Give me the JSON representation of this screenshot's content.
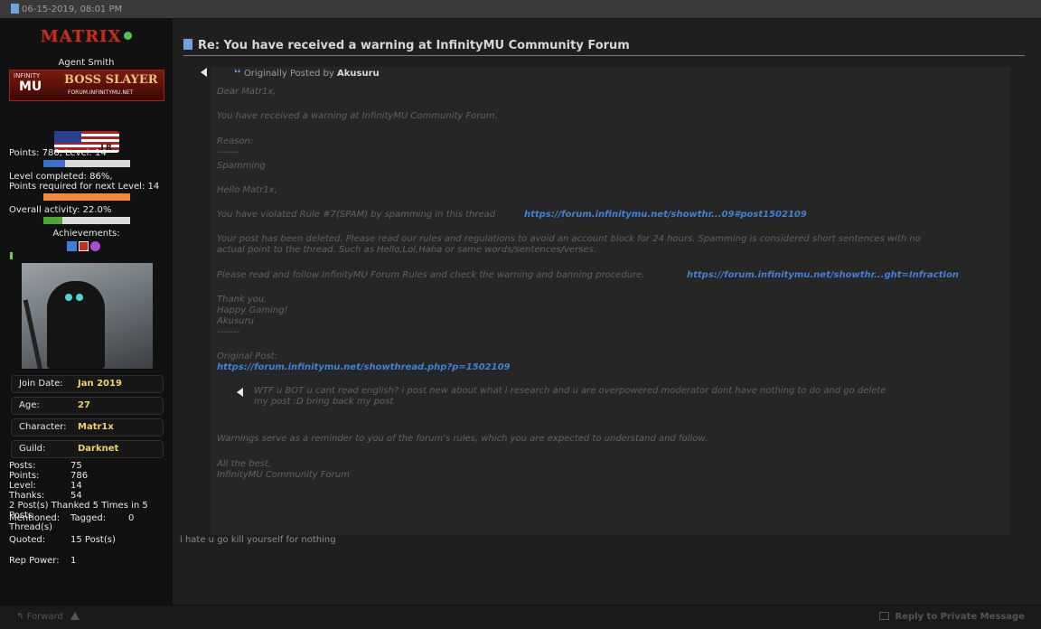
{
  "header": {
    "date": "06-15-2019, 08:01 PM"
  },
  "sidebar": {
    "username": "MATRIX",
    "user_title": "Agent Smith",
    "banner": {
      "line1": "INFINITY",
      "line2": "BOSS SLAYER",
      "line3": "FORUM.INFINITYMU.NET",
      "mu": "MU"
    },
    "flag_label": ".LR",
    "points_level": "Points: 786, Level: 14",
    "level_completed": "Level completed: 86%,",
    "points_required": "Points required for next Level: 14",
    "overall_activity": "Overall activity: 22.0%",
    "achievements_label": "Achievements:",
    "progress": {
      "level_fill": 0.25,
      "points_fill": 1.0,
      "activity_fill": 0.22
    },
    "info_rows": [
      {
        "label": "Join Date:",
        "value": "Jan 2019"
      },
      {
        "label": "Age:",
        "value": "27"
      },
      {
        "label": "Character:",
        "value": "Matr1x"
      },
      {
        "label": "Guild:",
        "value": "Darknet"
      }
    ],
    "posts_label": "Posts:",
    "posts_value": "75",
    "points_label": "Points:",
    "points_value": "786",
    "level_label": "Level:",
    "level_value": "14",
    "thanks_label": "Thanks:",
    "thanks_value": "54",
    "thanked_line": "2 Post(s) Thanked 5 Times in 5 Posts",
    "mentioned_label": "Mentioned:",
    "thread_label": "Thread(s)",
    "tagged_label": "Tagged:",
    "tagged_value": "0",
    "quoted_label": "Quoted:",
    "quoted_value": "15 Post(s)",
    "rep_label": "Rep Power:",
    "rep_value": "1"
  },
  "post": {
    "title": "Re: You have received a warning at InfinityMU Community Forum",
    "quote": {
      "head_prefix": "Originally Posted by",
      "author": "Akusuru",
      "lines": [
        "Dear Matr1x,",
        "You have received a warning at InfinityMU Community Forum.",
        "Reason:",
        "-------",
        "Spamming",
        "Hello Matr1x,",
        "You have violated Rule #7(SPAM) by spamming in this thread",
        "Your post has been deleted. Please read our rules and regulations to avoid an account block for 24 hours. Spamming is considered short sentences with no",
        "actual point to the thread. Such as Hello,Lol,Haha or same words/sentences/verses.",
        "Please read and follow InfinityMU Forum Rules and check the warning and banning procedure.",
        "Thank you,",
        "Happy Gaming!",
        "Akusuru",
        "-------",
        "Original Post:",
        "Warnings serve as a reminder to you of the forum's rules, which you are expected to understand and follow.",
        "All the best,",
        "InfinityMU Community Forum"
      ],
      "link1": "https://forum.infinitymu.net/showthr...09#post1502109",
      "link2": "https://forum.infinitymu.net/showthr...ght=Infraction",
      "link3": "https://forum.infinitymu.net/showthread.php?p=1502109",
      "nested_line1": "WTF u BOT u cant read english? i post new about what i research and u are overpowered moderator dont have nothing to do and go delete",
      "nested_line2": "my post :D bring back my post"
    },
    "reply_text": "i hate u go kill yourself for nothing"
  },
  "footer": {
    "forward": "Forward",
    "reply_pm": "Reply to Private Message"
  }
}
